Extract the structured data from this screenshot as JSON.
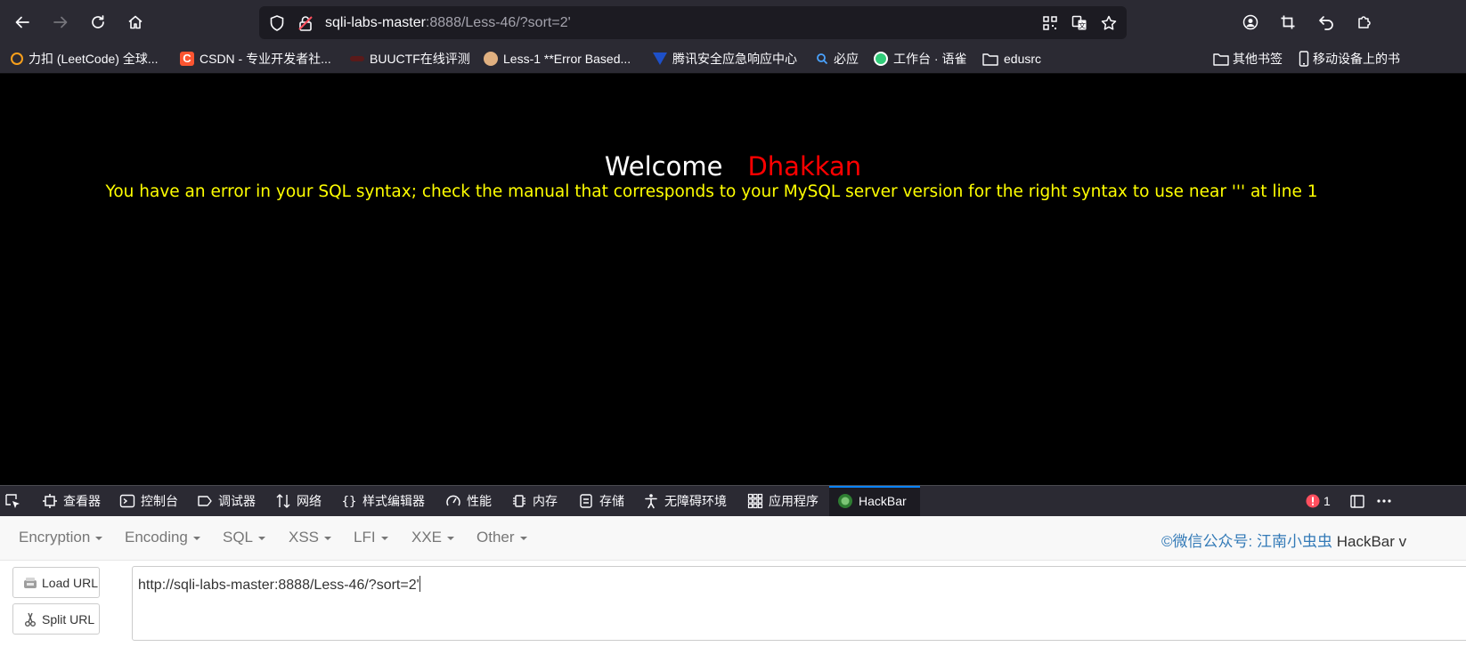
{
  "browser": {
    "url_host": "sqli-labs-master",
    "url_rest": ":8888/Less-46/?sort=2'"
  },
  "bookmarks": [
    {
      "label": "力扣 (LeetCode) 全球...",
      "color": "#f89f1b"
    },
    {
      "label": "CSDN - 专业开发者社...",
      "color": "#fc5531"
    },
    {
      "label": "BUUCTF在线评测",
      "color": "#c0392b"
    },
    {
      "label": "Less-1 **Error Based...",
      "color": "#e0b080"
    },
    {
      "label": "腾讯安全应急响应中心",
      "color": "#1e50c8"
    },
    {
      "label": "必应",
      "color": "#4aa3ff"
    },
    {
      "label": "工作台 · 语雀",
      "color": "#31cc79"
    },
    {
      "label": "edusrc",
      "color": ""
    },
    {
      "label": "其他书签",
      "color": ""
    },
    {
      "label": "移动设备上的书",
      "color": ""
    }
  ],
  "page": {
    "welcome": "Welcome",
    "name": "Dhakkan",
    "error": "You have an error in your SQL syntax; check the manual that corresponds to your MySQL server version for the right syntax to use near ''' at line 1"
  },
  "devtools": {
    "tabs": [
      "查看器",
      "控制台",
      "调试器",
      "网络",
      "样式编辑器",
      "性能",
      "内存",
      "存储",
      "无障碍环境",
      "应用程序",
      "HackBar"
    ],
    "error_count": "1"
  },
  "hackbar": {
    "menu": [
      "Encryption",
      "Encoding",
      "SQL",
      "XSS",
      "LFI",
      "XXE",
      "Other"
    ],
    "credit": "©微信公众号: 江南小虫虫",
    "credit_tail": "HackBar v",
    "load_url": "Load URL",
    "split_url": "Split URL",
    "url_value": "http://sqli-labs-master:8888/Less-46/?sort=2'"
  },
  "colors": {
    "chrome_bg": "#2b2a33",
    "name_red": "#ff0000",
    "error_yellow": "#ffff00",
    "link_blue": "#337ab7"
  }
}
